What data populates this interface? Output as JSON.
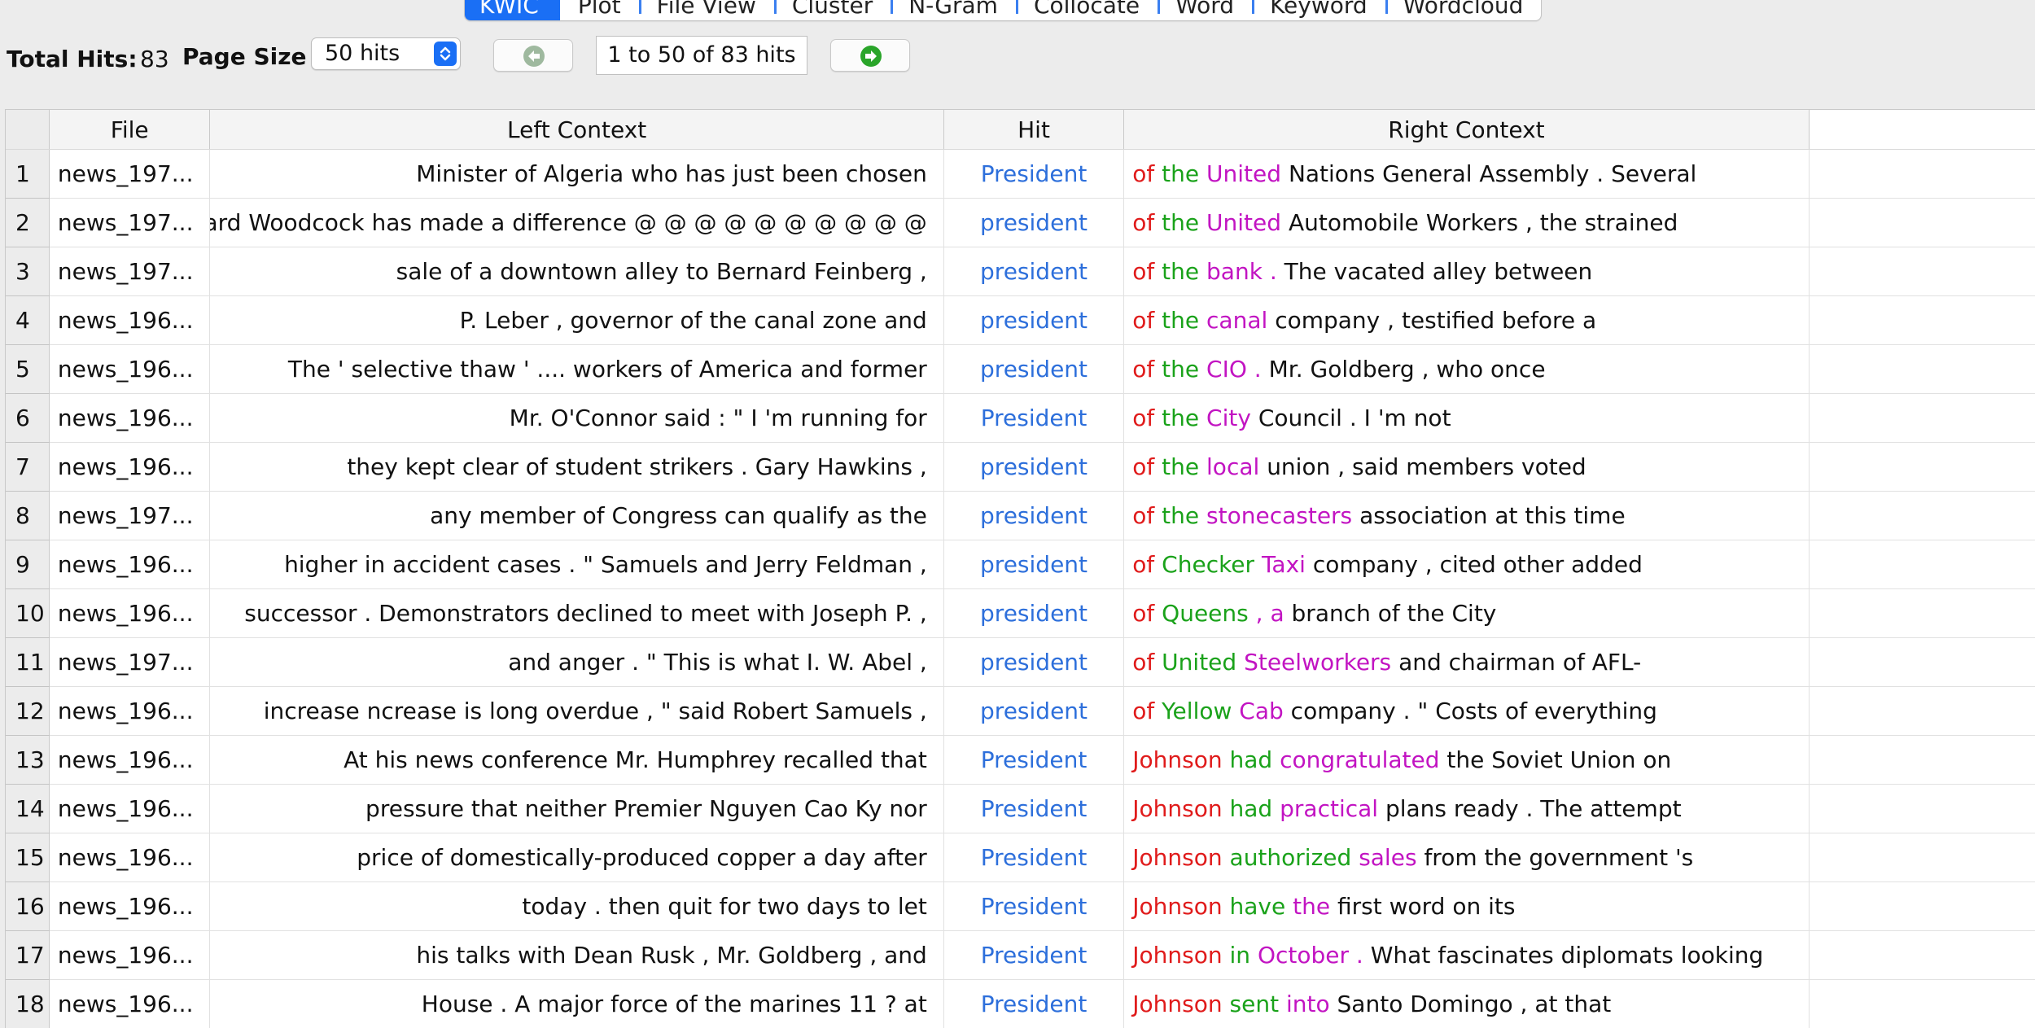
{
  "tabs": [
    {
      "label": "KWIC",
      "active": true
    },
    {
      "label": "Plot",
      "active": false
    },
    {
      "label": "File View",
      "active": false
    },
    {
      "label": "Cluster",
      "active": false
    },
    {
      "label": "N-Gram",
      "active": false
    },
    {
      "label": "Collocate",
      "active": false
    },
    {
      "label": "Word",
      "active": false
    },
    {
      "label": "Keyword",
      "active": false
    },
    {
      "label": "Wordcloud",
      "active": false
    }
  ],
  "toolbar": {
    "total_hits_label": "Total Hits:",
    "total_hits_value": "83",
    "page_size_label": "Page Size",
    "page_size_value": "50 hits",
    "page_range": "1 to 50 of 83 hits",
    "prev_icon": "back-arrow-icon",
    "next_icon": "forward-arrow-icon"
  },
  "colors": {
    "accent": "#1a6ff5",
    "hit": "#2d6fdb",
    "r1": "#e01b1b",
    "r2": "#1aa21a",
    "r3": "#c214c2",
    "next_arrow": "#2aa52a",
    "prev_arrow": "#9fb99f"
  },
  "table": {
    "columns": [
      "",
      "File",
      "Left Context",
      "Hit",
      "Right Context"
    ],
    "rows": [
      {
        "n": "1",
        "file": "news_197...",
        "left": "Minister of Algeria who has just been chosen",
        "hit": "President",
        "r1": "of",
        "r2": "the",
        "r3": "United",
        "rest": "Nations General Assembly . Several"
      },
      {
        "n": "2",
        "file": "news_197...",
        "left": "ard Woodcock has made a difference @ @ @ @ @ @ @ @ @ @",
        "hit": "president",
        "r1": "of",
        "r2": "the",
        "r3": "United",
        "rest": "Automobile Workers , the strained"
      },
      {
        "n": "3",
        "file": "news_197...",
        "left": "sale of a downtown alley to Bernard Feinberg ,",
        "hit": "president",
        "r1": "of",
        "r2": "the",
        "r3": "bank .",
        "rest": "The vacated alley between"
      },
      {
        "n": "4",
        "file": "news_196...",
        "left": "P. Leber , governor of the canal zone and",
        "hit": "president",
        "r1": "of",
        "r2": "the",
        "r3": "canal",
        "rest": "company , testified before a"
      },
      {
        "n": "5",
        "file": "news_196...",
        "left": "The ' selective thaw ' .... workers of America and former",
        "hit": "president",
        "r1": "of",
        "r2": "the",
        "r3": "CIO .",
        "rest": "Mr. Goldberg , who once"
      },
      {
        "n": "6",
        "file": "news_196...",
        "left": "Mr. O'Connor said : \" I 'm running for",
        "hit": "President",
        "r1": "of",
        "r2": "the",
        "r3": "City",
        "rest": "Council . I 'm not"
      },
      {
        "n": "7",
        "file": "news_196...",
        "left": "they kept clear of student strikers . Gary Hawkins ,",
        "hit": "president",
        "r1": "of",
        "r2": "the",
        "r3": "local",
        "rest": "union , said members voted"
      },
      {
        "n": "8",
        "file": "news_197...",
        "left": "any member of Congress can qualify as the",
        "hit": "president",
        "r1": "of",
        "r2": "the",
        "r3": "stonecasters",
        "rest": "association at this time"
      },
      {
        "n": "9",
        "file": "news_196...",
        "left": "higher in accident cases . \" Samuels and Jerry Feldman ,",
        "hit": "president",
        "r1": "of",
        "r2": "Checker",
        "r3": "Taxi",
        "rest": "company , cited other added"
      },
      {
        "n": "10",
        "file": "news_196...",
        "left": "successor . Demonstrators declined to meet with Joseph P. ,",
        "hit": "president",
        "r1": "of",
        "r2": "Queens",
        "r3": ", a",
        "rest": "branch of the City"
      },
      {
        "n": "11",
        "file": "news_197...",
        "left": "and anger . \" This is what I. W. Abel ,",
        "hit": "president",
        "r1": "of",
        "r2": "United",
        "r3": "Steelworkers",
        "rest": "and chairman of AFL-"
      },
      {
        "n": "12",
        "file": "news_196...",
        "left": "increase ncrease is long overdue , \" said Robert Samuels ,",
        "hit": "president",
        "r1": "of",
        "r2": "Yellow",
        "r3": "Cab",
        "rest": "company . \" Costs of everything"
      },
      {
        "n": "13",
        "file": "news_196...",
        "left": "At his news conference Mr. Humphrey recalled that",
        "hit": "President",
        "r1": "Johnson",
        "r2": "had",
        "r3": "congratulated",
        "rest": "the Soviet Union on"
      },
      {
        "n": "14",
        "file": "news_196...",
        "left": "pressure that neither Premier Nguyen Cao Ky nor",
        "hit": "President",
        "r1": "Johnson",
        "r2": "had",
        "r3": "practical",
        "rest": "plans ready . The attempt"
      },
      {
        "n": "15",
        "file": "news_196...",
        "left": "price of domestically-produced copper a day after",
        "hit": "President",
        "r1": "Johnson",
        "r2": "authorized",
        "r3": "sales",
        "rest": "from the government 's"
      },
      {
        "n": "16",
        "file": "news_196...",
        "left": "today . then quit for two days to let",
        "hit": "President",
        "r1": "Johnson",
        "r2": "have",
        "r3": "the",
        "rest": "first word on its"
      },
      {
        "n": "17",
        "file": "news_196...",
        "left": "his talks with Dean Rusk , Mr. Goldberg , and",
        "hit": "President",
        "r1": "Johnson",
        "r2": "in",
        "r3": "October .",
        "rest": "What fascinates diplomats looking"
      },
      {
        "n": "18",
        "file": "news_196...",
        "left": "House . A major force of the marines 11 ? at",
        "hit": "President",
        "r1": "Johnson",
        "r2": "sent",
        "r3": "into",
        "rest": "Santo Domingo , at that"
      }
    ]
  }
}
